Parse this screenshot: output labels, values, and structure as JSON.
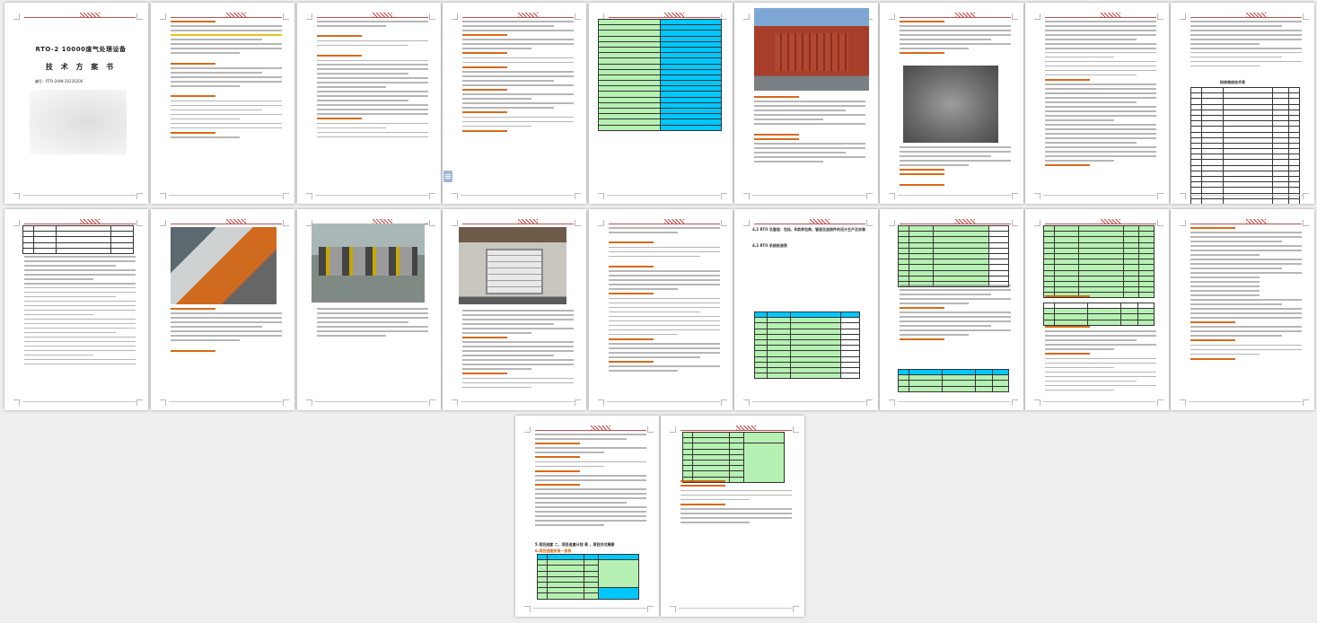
{
  "document": {
    "cover": {
      "title": "RTO-2 10000废气处理设备",
      "heading": "技 术 方 案 书",
      "number": "编号：RTO-2/HN-20230206"
    },
    "headings": {
      "page16": "4.2 RTO 及管道：包括、B类承包商，管道及连接件的设计生产及安装",
      "page16b": "4.3 RTO 系统检测表",
      "page10": "检修维修技术表",
      "page13": "1.1 RTO 系统概述",
      "page19_h1": "5 项目进度 二、项目进度计划 表 ，项目交付周期",
      "page19_h2": "6.项目进度安排一览表"
    }
  }
}
